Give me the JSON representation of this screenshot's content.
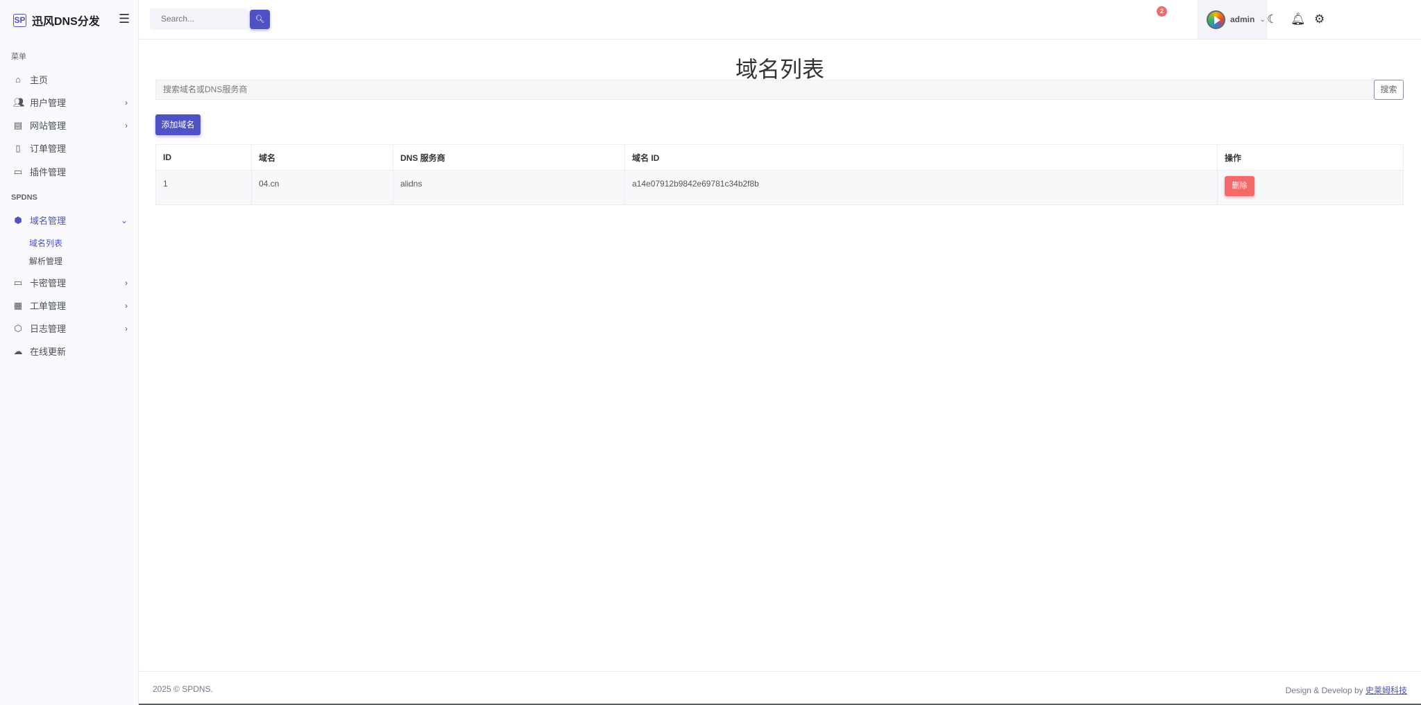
{
  "brand": {
    "logo": "SP",
    "name": "迅风DNS分发"
  },
  "header": {
    "search_placeholder": "Search...",
    "notification_count": "2",
    "user": "admin"
  },
  "sidebar": {
    "section_menu": "菜单",
    "items": [
      {
        "label": "主页"
      },
      {
        "label": "用户管理"
      },
      {
        "label": "网站管理"
      },
      {
        "label": "订单管理"
      },
      {
        "label": "插件管理"
      }
    ],
    "section_spdns": "SPDNS",
    "domain_group": {
      "label": "域名管理",
      "sub": [
        {
          "label": "域名列表"
        },
        {
          "label": "解析管理"
        }
      ]
    },
    "items2": [
      {
        "label": "卡密管理"
      },
      {
        "label": "工单管理"
      },
      {
        "label": "日志管理"
      },
      {
        "label": "在线更新"
      }
    ]
  },
  "main": {
    "title": "域名列表",
    "search_placeholder": "搜索域名或DNS服务商",
    "search_button": "搜索",
    "add_button": "添加域名",
    "table": {
      "headers": [
        "ID",
        "域名",
        "DNS 服务商",
        "域名 ID",
        "操作"
      ],
      "rows": [
        {
          "id": "1",
          "domain": "04.cn",
          "provider": "alidns",
          "domain_id": "a14e07912b9842e69781c34b2f8b",
          "action": "删除"
        }
      ]
    }
  },
  "footer": {
    "copyright": "2025 © SPDNS.",
    "credit": "Design & Develop by",
    "credit_link": "史莱姆科技"
  }
}
